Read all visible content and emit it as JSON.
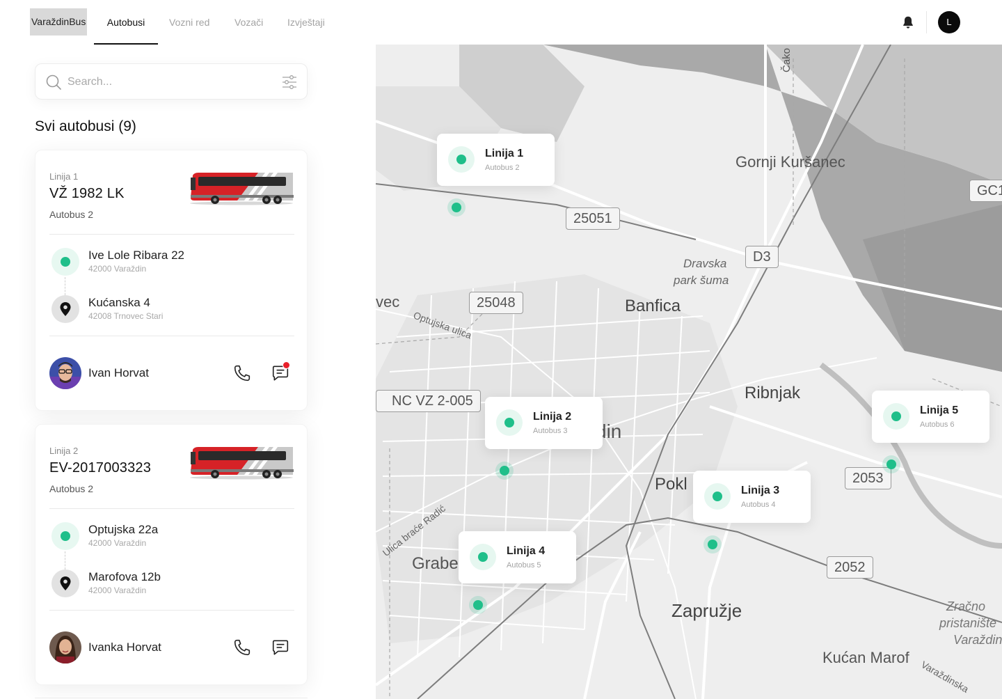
{
  "app": {
    "brand": "VaraždinBus",
    "nav": [
      {
        "label": "Autobusi",
        "active": true
      },
      {
        "label": "Vozni red",
        "active": false
      },
      {
        "label": "Vozači",
        "active": false
      },
      {
        "label": "Izvještaji",
        "active": false
      }
    ],
    "user_initial": "L",
    "icons": {
      "notifications": "bell-icon",
      "search": "search-icon",
      "filter": "sliders-icon"
    }
  },
  "colors": {
    "accent": "#1fbf8a",
    "accent_light": "#e6f7f0",
    "notification": "#e8202a",
    "bus_red": "#d62227"
  },
  "search": {
    "placeholder": "Search..."
  },
  "list": {
    "title": "Svi autobusi (9)",
    "buses": [
      {
        "line": "Linija 1",
        "plate": "VŽ 1982 LK",
        "name": "Autobus 2",
        "from": {
          "address": "Ive Lole Ribara 22",
          "city": "42000 Varaždin"
        },
        "to": {
          "address": "Kućanska 4",
          "city": "42008 Trnovec Stari"
        },
        "driver": "Ivan Horvat",
        "unread_messages": true
      },
      {
        "line": "Linija 2",
        "plate": "EV-2017003323",
        "name": "Autobus 2",
        "from": {
          "address": "Optujska 22a",
          "city": "42000 Varaždin"
        },
        "to": {
          "address": "Marofova 12b",
          "city": "42000 Varaždin"
        },
        "driver": "Ivanka Horvat",
        "unread_messages": false
      }
    ]
  },
  "map": {
    "place_labels": [
      "Gornji Kuršanec",
      "Banfica",
      "Ribnjak",
      "Zapružje",
      "Kućan Marof",
      "Grabe",
      "Pokl",
      "din",
      "vec",
      "Čako"
    ],
    "park_label": [
      "Dravska",
      "park šuma"
    ],
    "street_labels": [
      "Optujska ulica",
      "Ulica braće Radić",
      "Varaždinska"
    ],
    "airport_label": [
      "Zračno",
      "pristanište",
      "Varaždin"
    ],
    "road_shields": [
      "25051",
      "D3",
      "25048",
      "NC VZ 2-005",
      "2053",
      "2052",
      "GC1"
    ],
    "buses": [
      {
        "line": "Linija 1",
        "bus": "Autobus 2"
      },
      {
        "line": "Linija 2",
        "bus": "Autobus 3"
      },
      {
        "line": "Linija 3",
        "bus": "Autobus 4"
      },
      {
        "line": "Linija 4",
        "bus": "Autobus 5"
      },
      {
        "line": "Linija 5",
        "bus": "Autobus 6"
      }
    ]
  }
}
